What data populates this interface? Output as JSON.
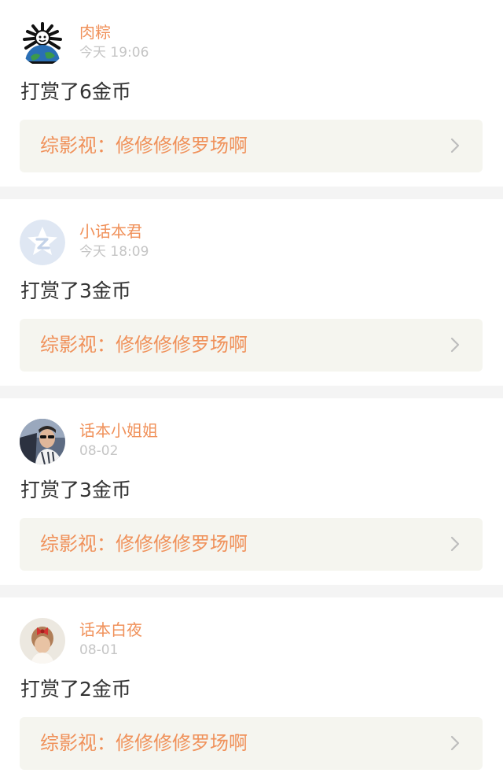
{
  "colors": {
    "accent": "#f0915a",
    "muted_time": "#c5c5c5",
    "body_text": "#333333",
    "link_bg": "#f5f5ef",
    "separator": "#f4f4f4"
  },
  "feed": {
    "items": [
      {
        "username": "肉粽",
        "time": "今天 19:06",
        "reward": "打赏了6金币",
        "work_label": "综影视：修修修修罗场啊",
        "avatar_icon": "cartoon-globe-avatar"
      },
      {
        "username": "小话本君",
        "time": "今天 18:09",
        "reward": "打赏了3金币",
        "work_label": "综影视：修修修修罗场啊",
        "avatar_icon": "qq-default-avatar"
      },
      {
        "username": "话本小姐姐",
        "time": "08-02",
        "reward": "打赏了3金币",
        "work_label": "综影视：修修修修罗场啊",
        "avatar_icon": "photo-avatar-sunglasses"
      },
      {
        "username": "话本白夜",
        "time": "08-01",
        "reward": "打赏了2金币",
        "work_label": "综影视：修修修修罗场啊",
        "avatar_icon": "photo-avatar-hair-bow"
      }
    ]
  }
}
